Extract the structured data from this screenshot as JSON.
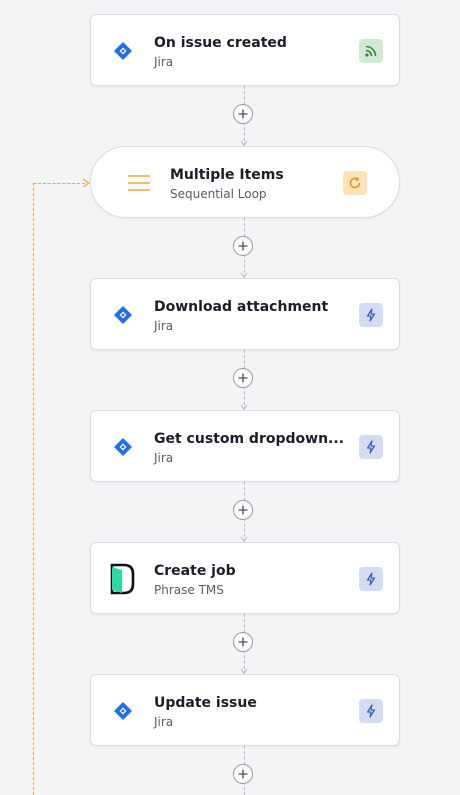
{
  "steps": [
    {
      "title": "On issue created",
      "subtitle": "Jira",
      "app_icon": "jira-icon",
      "badge": "trigger-rss-icon"
    },
    {
      "title": "Multiple Items",
      "subtitle": "Sequential Loop",
      "app_icon": "list-icon",
      "badge": "loop-icon"
    },
    {
      "title": "Download attachment",
      "subtitle": "Jira",
      "app_icon": "jira-icon",
      "badge": "action-bolt-icon"
    },
    {
      "title": "Get custom dropdown...",
      "subtitle": "Jira",
      "app_icon": "jira-icon",
      "badge": "action-bolt-icon"
    },
    {
      "title": "Create job",
      "subtitle": "Phrase TMS",
      "app_icon": "phrase-tms-icon",
      "badge": "action-bolt-icon"
    },
    {
      "title": "Update issue",
      "subtitle": "Jira",
      "app_icon": "jira-icon",
      "badge": "action-bolt-icon"
    }
  ],
  "colors": {
    "jira_blue": "#1f6fe5",
    "loop_orange": "#f0a83a",
    "trigger_green": "#2e8b3e",
    "action_blue": "#3a5fc0",
    "phrase_green": "#2fd8a0"
  }
}
